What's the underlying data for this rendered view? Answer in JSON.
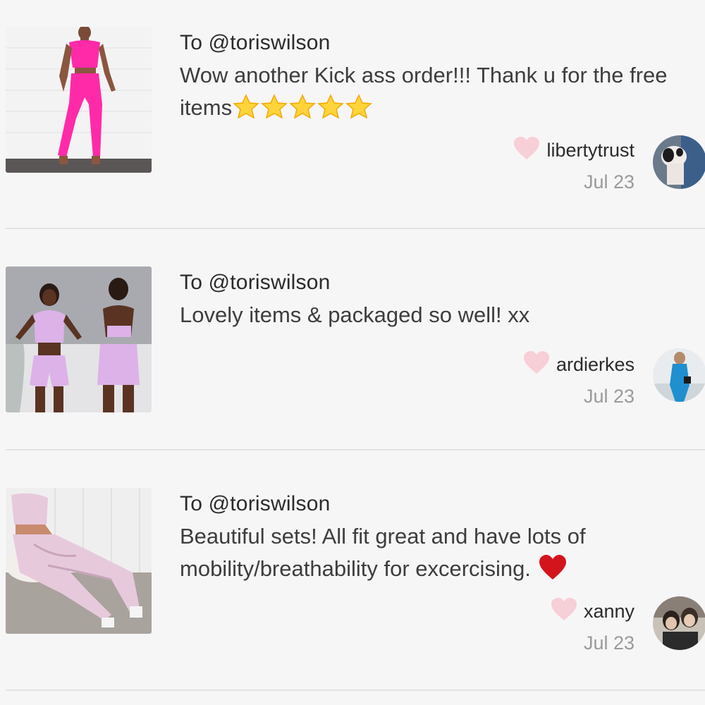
{
  "reviews": [
    {
      "to": "To @toriswilson",
      "message": "Wow another Kick ass order!!! Thank u for the free items",
      "emoji": "glowing-star",
      "emoji_count": 5,
      "username": "libertytrust",
      "date": "Jul 23",
      "photo_color": "#ff2aa8",
      "avatar_desc": "dog"
    },
    {
      "to": "To @toriswilson",
      "message": "Lovely items & packaged so well! xx",
      "username": "ardierkes",
      "date": "Jul 23",
      "photo_color": "#dcb2e8",
      "avatar_desc": "person-blue"
    },
    {
      "to": "To @toriswilson",
      "message": "Beautiful sets! All fit great and have lots of mobility/breathability for excercising.",
      "emoji": "red-heart",
      "username": "xanny",
      "date": "Jul 23",
      "photo_color": "#e7c9dc",
      "avatar_desc": "two-people"
    }
  ],
  "colors": {
    "like_heart": "#f7cfd6",
    "background": "#f7f6f7",
    "divider": "#e3e2e3"
  }
}
